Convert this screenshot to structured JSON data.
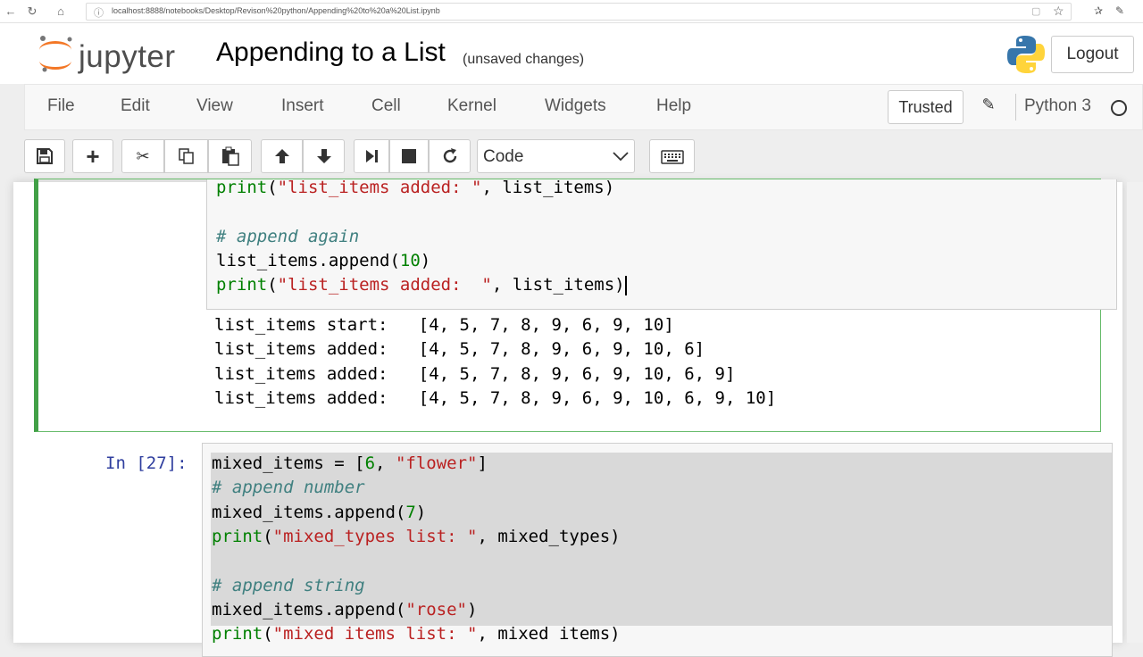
{
  "browser": {
    "url": "localhost:8888/notebooks/Desktop/Revison%20python/Appending%20to%20a%20List.ipynb"
  },
  "header": {
    "logo_text": "jupyter",
    "notebook_title": "Appending to a List",
    "save_status": "(unsaved changes)",
    "logout_label": "Logout"
  },
  "menubar": {
    "items": [
      "File",
      "Edit",
      "View",
      "Insert",
      "Cell",
      "Kernel",
      "Widgets",
      "Help"
    ],
    "trusted_label": "Trusted",
    "kernel_name": "Python 3"
  },
  "toolbar": {
    "cell_type": "Code"
  },
  "cell1": {
    "code_lines": [
      {
        "parts": [
          [
            "fn",
            "print"
          ],
          [
            "plain",
            "("
          ],
          [
            "str",
            "\"list_items added: \""
          ],
          [
            "plain",
            ", list_items)"
          ]
        ]
      },
      {
        "parts": []
      },
      {
        "parts": [
          [
            "cmt",
            "# append again"
          ]
        ]
      },
      {
        "parts": [
          [
            "plain",
            "list_items.append("
          ],
          [
            "num",
            "10"
          ],
          [
            "plain",
            ")"
          ]
        ]
      },
      {
        "parts": [
          [
            "fn",
            "print"
          ],
          [
            "plain",
            "("
          ],
          [
            "str",
            "\"list_items added:  \""
          ],
          [
            "plain",
            ", list_items)"
          ]
        ]
      }
    ],
    "output_lines": [
      "list_items start:   [4, 5, 7, 8, 9, 6, 9, 10]",
      "list_items added:   [4, 5, 7, 8, 9, 6, 9, 10, 6]",
      "list_items added:   [4, 5, 7, 8, 9, 6, 9, 10, 6, 9]",
      "list_items added:   [4, 5, 7, 8, 9, 6, 9, 10, 6, 9, 10]"
    ]
  },
  "cell2": {
    "prompt": "In [27]:",
    "code_lines": [
      {
        "parts": [
          [
            "plain",
            "mixed_items = ["
          ],
          [
            "num",
            "6"
          ],
          [
            "plain",
            ", "
          ],
          [
            "str",
            "\"flower\""
          ],
          [
            "plain",
            "]"
          ]
        ]
      },
      {
        "parts": [
          [
            "cmt",
            "# append number"
          ]
        ]
      },
      {
        "parts": [
          [
            "plain",
            "mixed_items.append("
          ],
          [
            "num",
            "7"
          ],
          [
            "plain",
            ")"
          ]
        ]
      },
      {
        "parts": [
          [
            "fn",
            "print"
          ],
          [
            "plain",
            "("
          ],
          [
            "str",
            "\"mixed_types list: \""
          ],
          [
            "plain",
            ", mixed_types)"
          ]
        ]
      },
      {
        "parts": []
      },
      {
        "parts": [
          [
            "cmt",
            "# append string"
          ]
        ]
      },
      {
        "parts": [
          [
            "plain",
            "mixed_items.append("
          ],
          [
            "str",
            "\"rose\""
          ],
          [
            "plain",
            ")"
          ]
        ]
      },
      {
        "parts": [
          [
            "fn",
            "print"
          ],
          [
            "plain",
            "("
          ],
          [
            "str",
            "\"mixed items list: \""
          ],
          [
            "plain",
            ", mixed items)"
          ]
        ]
      }
    ]
  },
  "colors": {
    "selected_cell_border": "#42a047",
    "prompt_blue": "#303f9f",
    "string_red": "#ba2121",
    "keyword_green": "#008000",
    "comment_teal": "#408080"
  }
}
